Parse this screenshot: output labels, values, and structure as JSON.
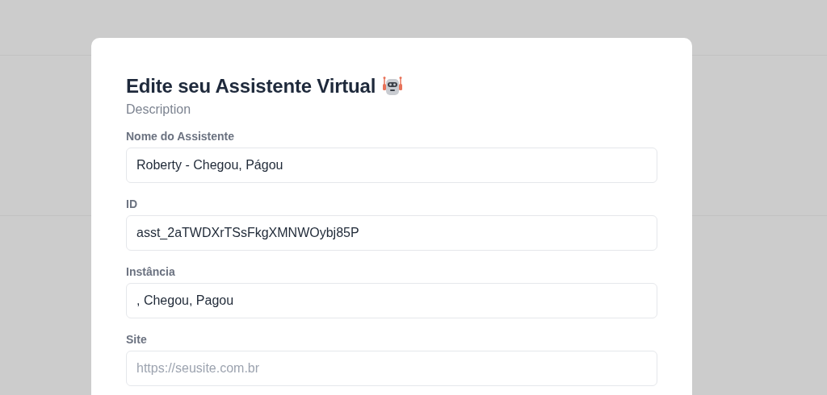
{
  "dialog": {
    "title": "Edite seu Assistente Virtual",
    "description": "Description",
    "fields": [
      {
        "label": "Nome do Assistente",
        "value": "Roberty - Chegou, Págou"
      },
      {
        "label": "ID",
        "value": "asst_2aTWDXrTSsFkgXMNWOybj85P"
      },
      {
        "label": "Instância",
        "value": ", Chegou, Pagou"
      },
      {
        "label": "Site",
        "placeholder": "https://seusite.com.br"
      }
    ]
  }
}
